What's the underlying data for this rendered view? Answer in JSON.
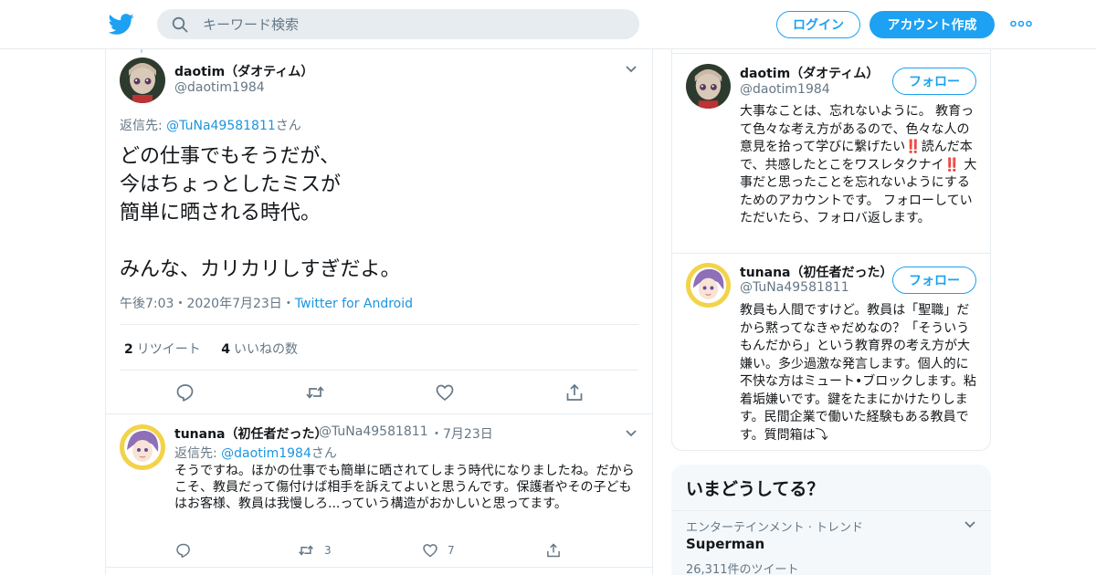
{
  "header": {
    "search_placeholder": "キーワード検索",
    "login_label": "ログイン",
    "signup_label": "アカウント作成",
    "brand_color": "#1da1f2"
  },
  "main_tweet": {
    "display_name": "daotim（ダオティム）",
    "handle": "@daotim1984",
    "reply_prefix": "返信先: ",
    "reply_to": "@TuNa49581811",
    "reply_suffix": "さん",
    "text": "どの仕事でもそうだが、\n今はちょっとしたミスが\n簡単に晒される時代。\n\nみんな、カリカリしすぎだよ。",
    "time": "午後7:03",
    "date": "2020年7月23日",
    "sep": "・",
    "source": "Twitter for Android",
    "retweet_count": "2",
    "retweet_label": "リツイート",
    "like_count": "4",
    "like_label": "いいねの数"
  },
  "reply_tweet": {
    "display_name": "tunana（初任者だった）",
    "handle": "@TuNa49581811",
    "date": "・7月23日",
    "reply_prefix": "返信先: ",
    "reply_to": "@daotim1984",
    "reply_suffix": "さん",
    "text": "そうですね。ほかの仕事でも簡単に晒されてしまう時代になりましたね。だからこそ、教員だって傷付けば相手を訴えてよいと思うんです。保護者やその子どもはお客様、教員は我慢しろ...っていう構造がおかしいと思ってます。",
    "retweet_count": "3",
    "like_count": "7"
  },
  "sidebar_profiles": [
    {
      "display_name": "daotim（ダオティム）",
      "handle": "@daotim1984",
      "follow_label": "フォロー",
      "bio": "大事なことは、忘れないように。 教育って色々な考え方があるので、色々な人の意見を拾って学びに繋げたい‼️読んだ本で、共感したとこをワスレタクナイ‼️ 大事だと思ったことを忘れないようにするためのアカウントです。 フォローしていただいたら、フォロバ返します。"
    },
    {
      "display_name": "tunana（初任者だった）",
      "handle": "@TuNa49581811",
      "follow_label": "フォロー",
      "bio": "教員も人間ですけど。教員は「聖職」だから黙ってなきゃだめなの？「そういうもんだから」という教育界の考え方が大嫌い。多少過激な発言します。個人的に不快な方はミュート•ブロックします。粘着垢嫌いです。鍵をたまにかけたりします。民間企業で働いた経験もある教員です。質問箱は⤵"
    }
  ],
  "trends": {
    "title": "いまどうしてる？",
    "items": [
      {
        "category": "エンターテインメント · トレンド",
        "name": "Superman",
        "count": "26,311件のツイート"
      }
    ]
  }
}
